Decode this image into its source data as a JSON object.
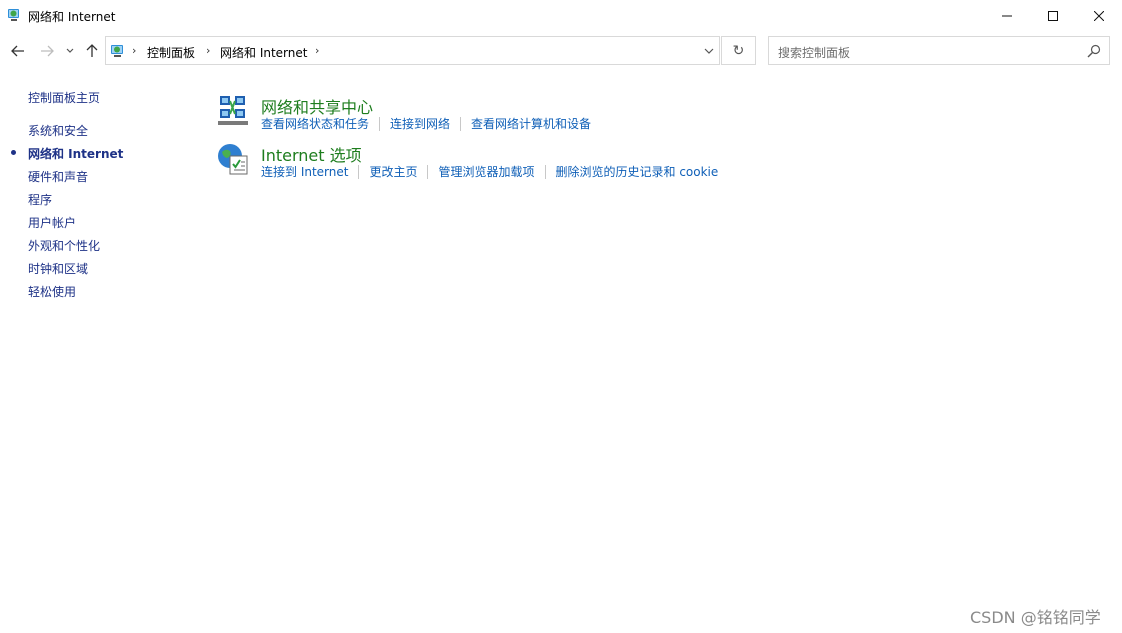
{
  "window": {
    "title": "网络和 Internet"
  },
  "nav": {
    "breadcrumbs": [
      "控制面板",
      "网络和 Internet"
    ],
    "search_placeholder": "搜索控制面板"
  },
  "sidebar": {
    "home": "控制面板主页",
    "items": [
      "系统和安全",
      "网络和 Internet",
      "硬件和声音",
      "程序",
      "用户帐户",
      "外观和个性化",
      "时钟和区域",
      "轻松使用"
    ],
    "active_index": 1
  },
  "categories": [
    {
      "title": "网络和共享中心",
      "icon": "network-sharing-center-icon",
      "links": [
        "查看网络状态和任务",
        "连接到网络",
        "查看网络计算机和设备"
      ]
    },
    {
      "title": "Internet 选项",
      "icon": "internet-options-icon",
      "links": [
        "连接到 Internet",
        "更改主页",
        "管理浏览器加载项",
        "删除浏览的历史记录和 cookie"
      ]
    }
  ],
  "watermark": "CSDN @铭铭同学",
  "colors": {
    "link": "#0f5fb7",
    "category_title": "#1e7d1e",
    "sidebar_text": "#1e3287"
  }
}
